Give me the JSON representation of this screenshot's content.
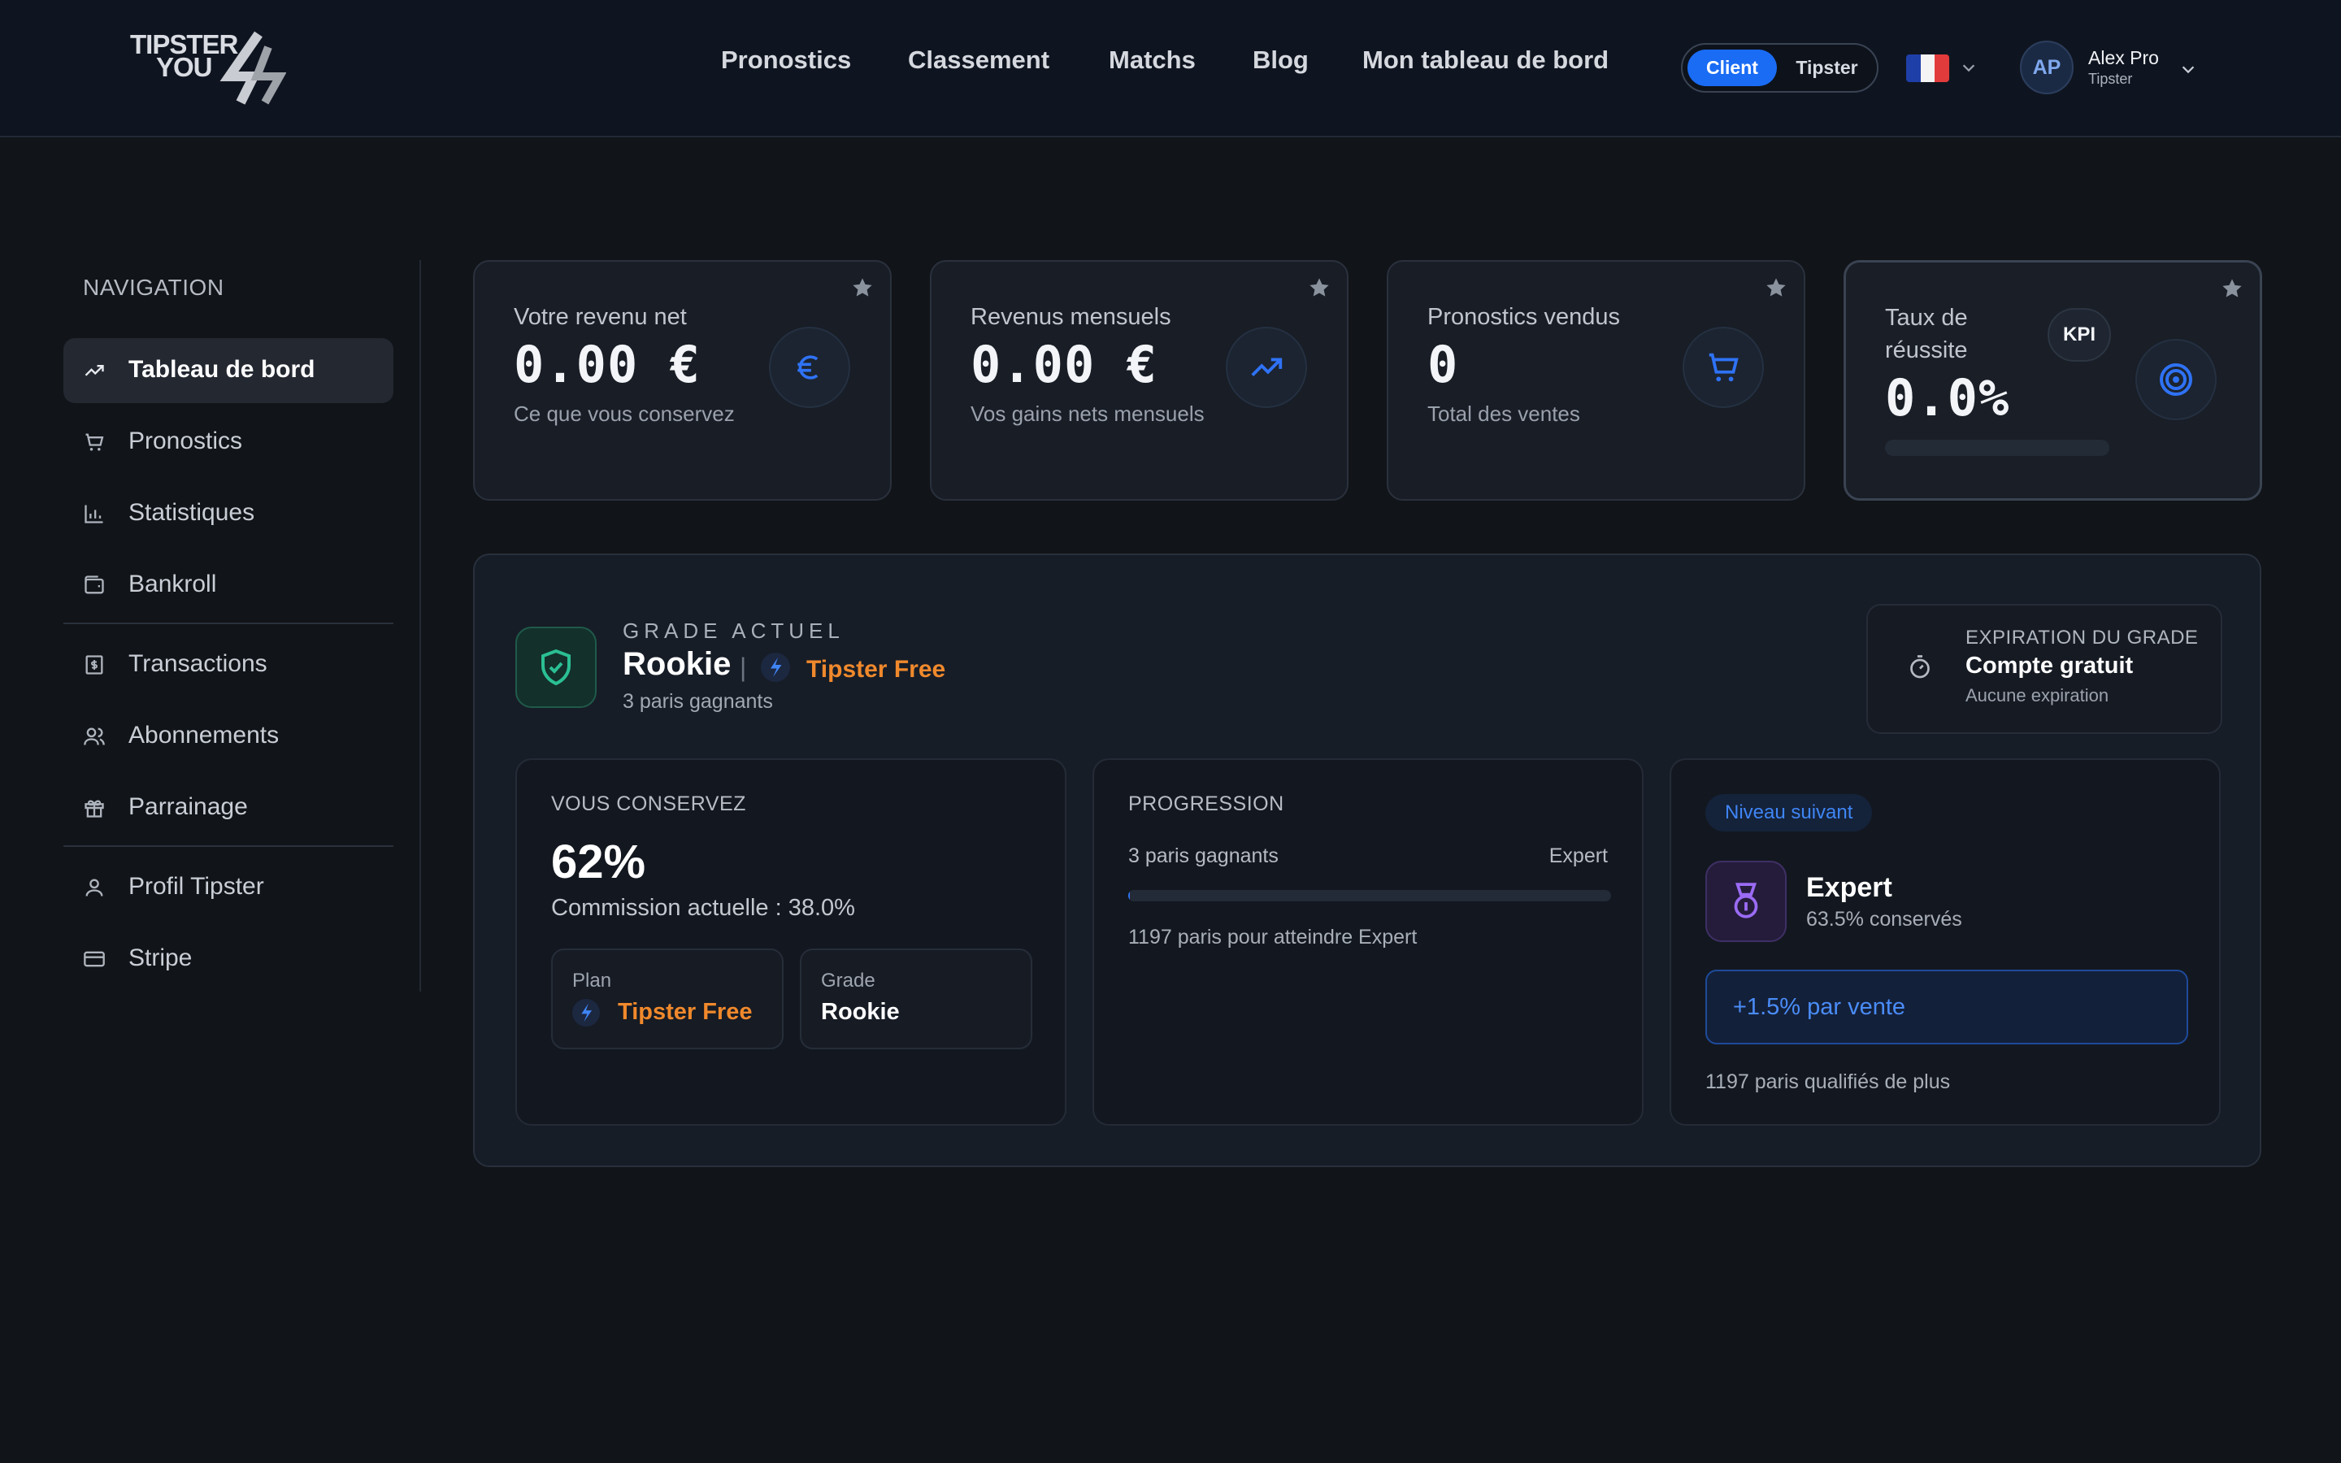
{
  "brand": {
    "line1": "TIPSTER",
    "line2": "YOU"
  },
  "header": {
    "nav": [
      {
        "label": "Pronostics"
      },
      {
        "label": "Classement"
      },
      {
        "label": "Matchs"
      },
      {
        "label": "Blog"
      },
      {
        "label": "Mon tableau de bord"
      }
    ],
    "mode_toggle": {
      "active": "Client",
      "inactive": "Tipster"
    },
    "language": {
      "flag": "fr",
      "colors": [
        "#1f3fa8",
        "#f4f4f4",
        "#e23b3b"
      ]
    },
    "user": {
      "initials": "AP",
      "name": "Alex Pro",
      "role": "Tipster"
    }
  },
  "sidebar": {
    "title": "NAVIGATION",
    "items": [
      {
        "label": "Tableau de bord",
        "icon": "trending-up-icon",
        "active": true
      },
      {
        "label": "Pronostics",
        "icon": "cart-icon"
      },
      {
        "label": "Statistiques",
        "icon": "bar-chart-icon"
      },
      {
        "label": "Bankroll",
        "icon": "wallet-icon"
      },
      {
        "label": "Transactions",
        "icon": "receipt-dollar-icon"
      },
      {
        "label": "Abonnements",
        "icon": "users-icon"
      },
      {
        "label": "Parrainage",
        "icon": "gift-icon"
      },
      {
        "label": "Profil Tipster",
        "icon": "user-icon"
      },
      {
        "label": "Stripe",
        "icon": "credit-card-icon"
      }
    ]
  },
  "kpis": [
    {
      "label": "Votre revenu net",
      "value": "0.00 €",
      "sub": "Ce que vous conservez",
      "icon": "euro-icon"
    },
    {
      "label": "Revenus mensuels",
      "value": "0.00 €",
      "sub": "Vos gains nets mensuels",
      "icon": "trending-up-icon"
    },
    {
      "label": "Pronostics vendus",
      "value": "0",
      "sub": "Total des ventes",
      "icon": "cart-icon"
    },
    {
      "label_line1": "Taux de",
      "label_line2": "réussite",
      "badge": "KPI",
      "value": "0.0%",
      "progress": 0,
      "icon": "target-icon"
    }
  ],
  "grade": {
    "eyebrow": "GRADE ACTUEL",
    "name": "Rookie",
    "separator": "|",
    "plan": "Tipster Free",
    "wins": "3 paris gagnants",
    "expiration": {
      "eyebrow": "EXPIRATION DU GRADE",
      "title": "Compte gratuit",
      "sub": "Aucune expiration"
    },
    "keep": {
      "eyebrow": "VOUS CONSERVEZ",
      "percent": "62%",
      "commission": "Commission actuelle : 38.0%",
      "plan_label": "Plan",
      "plan_value": "Tipster Free",
      "grade_label": "Grade",
      "grade_value": "Rookie"
    },
    "progress": {
      "eyebrow": "PROGRESSION",
      "left": "3 paris gagnants",
      "right": "Expert",
      "fraction": 0.0025,
      "note": "1197 paris pour atteindre Expert"
    },
    "next": {
      "badge": "Niveau suivant",
      "title": "Expert",
      "sub": "63.5% conservés",
      "bonus": "+1.5% par vente",
      "note": "1197 paris qualifiés de plus"
    }
  },
  "colors": {
    "accent": "#1a6cf5",
    "orange": "#f0892c",
    "teal": "#2bbf94",
    "purple": "#8b5cf6"
  }
}
